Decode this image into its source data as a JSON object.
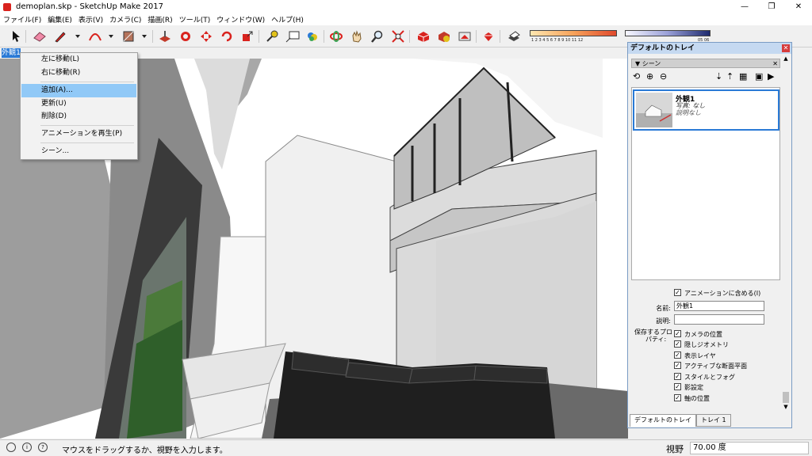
{
  "window": {
    "title": "demoplan.skp - SketchUp Make 2017",
    "min_glyph": "—",
    "max_glyph": "❐",
    "close_glyph": "✕"
  },
  "menu": [
    "ファイル(F)",
    "編集(E)",
    "表示(V)",
    "カメラ(C)",
    "描画(R)",
    "ツール(T)",
    "ウィンドウ(W)",
    "ヘルプ(H)"
  ],
  "toolbar": {
    "tools": [
      "select",
      "eraser",
      "pencil",
      "arc",
      "shape",
      "push-pull",
      "follow-me",
      "move",
      "rotate",
      "scale",
      "tape-measure",
      "text",
      "paint-bucket",
      "orbit",
      "pan",
      "zoom",
      "zoom-extents",
      "warehouse",
      "extension-warehouse",
      "share-model",
      "layout",
      "components",
      "shadow"
    ],
    "scale_min_label": "1 2 3 4 5 6 7 8 9 10 11 12",
    "scale_max_label": "05 06",
    "accent": "#d9231e"
  },
  "scene_tab": {
    "label": "外観1",
    "color": "#2a7ad6"
  },
  "context_menu": {
    "items": [
      {
        "label": "左に移動(L)"
      },
      {
        "label": "右に移動(R)"
      },
      {
        "label": "追加(A)..."
      },
      {
        "label": "更新(U)"
      },
      {
        "label": "削除(D)"
      },
      {
        "label": "アニメーションを再生(P)"
      },
      {
        "label": "シーン..."
      }
    ],
    "highlight_color": "#91c9f7"
  },
  "tray": {
    "title": "デフォルトのトレイ",
    "panel_title": "▼ シーン",
    "panel_close": "✕",
    "tools": [
      "⟲",
      "⊕",
      "⊖",
      "⇣",
      "⇡",
      "▦",
      "▣",
      "▶"
    ],
    "scene": {
      "name": "外観1",
      "photo": "写真: なし",
      "description": "説明なし"
    },
    "include_animation": {
      "label": "アニメーションに含める(I)",
      "checked": true
    },
    "name_label": "名前:",
    "name_value": "外観1",
    "description_label": "説明:",
    "description_value": "",
    "properties_label_1": "保存するプロ",
    "properties_label_2": "パティ:",
    "properties": [
      {
        "label": "カメラの位置",
        "checked": true
      },
      {
        "label": "隠しジオメトリ",
        "checked": true
      },
      {
        "label": "表示レイヤ",
        "checked": true
      },
      {
        "label": "アクティブな断面平面",
        "checked": true
      },
      {
        "label": "スタイルとフォグ",
        "checked": true
      },
      {
        "label": "影設定",
        "checked": true
      },
      {
        "label": "軸の位置",
        "checked": true
      }
    ],
    "tabs": [
      {
        "label": "デフォルトのトレイ"
      },
      {
        "label": "トレイ 1"
      }
    ],
    "check_glyph": "✓",
    "scroll_up": "▲",
    "scroll_down": "▼"
  },
  "status": {
    "icons": [
      "i",
      "?"
    ],
    "message": "マウスをドラッグするか、視野を入力します。",
    "vcb_label": "視野",
    "vcb_value": "70.00 度"
  }
}
